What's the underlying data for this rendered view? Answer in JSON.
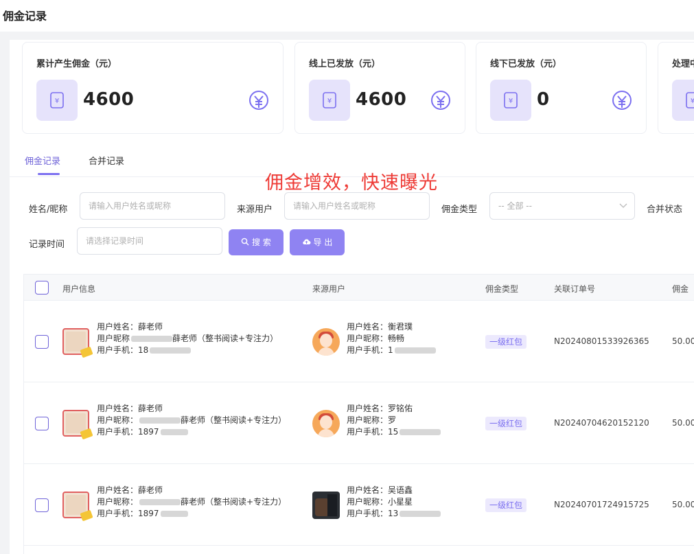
{
  "page": {
    "title": "佣金记录"
  },
  "cards": [
    {
      "label": "累计产生佣金（元）",
      "value": "4600"
    },
    {
      "label": "线上已发放（元）",
      "value": "4600"
    },
    {
      "label": "线下已发放（元）",
      "value": "0"
    },
    {
      "label": "处理中"
    }
  ],
  "tabs": [
    {
      "label": "佣金记录",
      "active": true
    },
    {
      "label": "合并记录",
      "active": false
    }
  ],
  "overlay_text": "佣金增效，快速曝光",
  "filters": {
    "name_label": "姓名/昵称",
    "name_placeholder": "请输入用户姓名或昵称",
    "source_label": "来源用户",
    "source_placeholder": "请输入用户姓名或昵称",
    "type_label": "佣金类型",
    "type_selected": "-- 全部 --",
    "merge_label": "合并状态",
    "time_label": "记录时间",
    "time_placeholder": "请选择记录时间",
    "search_label": "搜 索",
    "export_label": "导 出"
  },
  "table": {
    "headers": [
      "用户信息",
      "来源用户",
      "佣金类型",
      "关联订单号",
      "佣金"
    ],
    "rows": [
      {
        "user_name": "用户姓名：薛老师",
        "user_nick_pre": "用户昵称",
        "user_nick": "薛老师（整书阅读+专注力）",
        "user_phone": "用户手机：18",
        "src_name": "用户姓名：衡君璞",
        "src_nick": "用户昵称：畅畅",
        "src_phone": "用户手机：1",
        "type": "一级红包",
        "order": "N20240801533926365",
        "amount": "50.00"
      },
      {
        "user_name": "用户姓名：薛老师",
        "user_nick_pre": "用户昵称：",
        "user_nick": "薛老师（整书阅读+专注力）",
        "user_phone": "用户手机：1897",
        "src_name": "用户姓名：罗铭佑",
        "src_nick": "用户昵称：罗",
        "src_phone": "用户手机：15",
        "type": "一级红包",
        "order": "N20240704620152120",
        "amount": "50.00"
      },
      {
        "user_name": "用户姓名：薛老师",
        "user_nick_pre": "用户昵称：",
        "user_nick": "薛老师（整书阅读+专注力）",
        "user_phone": "用户手机：1897",
        "src_name": "用户姓名：吴语鑫",
        "src_nick": "用户昵称：小星星",
        "src_phone": "用户手机：13",
        "type": "一级红包",
        "order": "N20240701724915725",
        "amount": "50.00"
      }
    ]
  },
  "colors": {
    "accent": "#7b6ff0",
    "overlay": "#ee3b36"
  }
}
